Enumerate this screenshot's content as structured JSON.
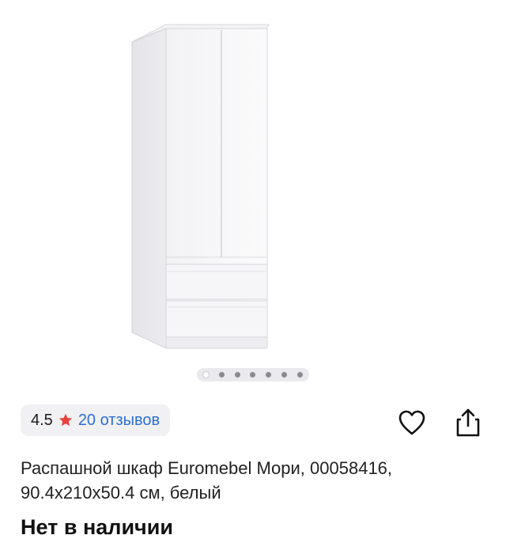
{
  "product": {
    "image_alt": "white two-door wardrobe with two drawers",
    "carousel": {
      "total": 7,
      "active": 0
    },
    "rating": {
      "value": "4.5",
      "reviews_label": "20 отзывов"
    },
    "title": "Распашной шкаф Euromebel Мори, 00058416, 90.4x210x50.4 см, белый",
    "availability": "Нет в наличии"
  },
  "icons": {
    "star": "star-icon",
    "favorite": "heart-icon",
    "share": "share-icon"
  },
  "colors": {
    "star": "#e8413a",
    "link": "#2c6fd1",
    "pill_bg": "#f1f1f4"
  }
}
